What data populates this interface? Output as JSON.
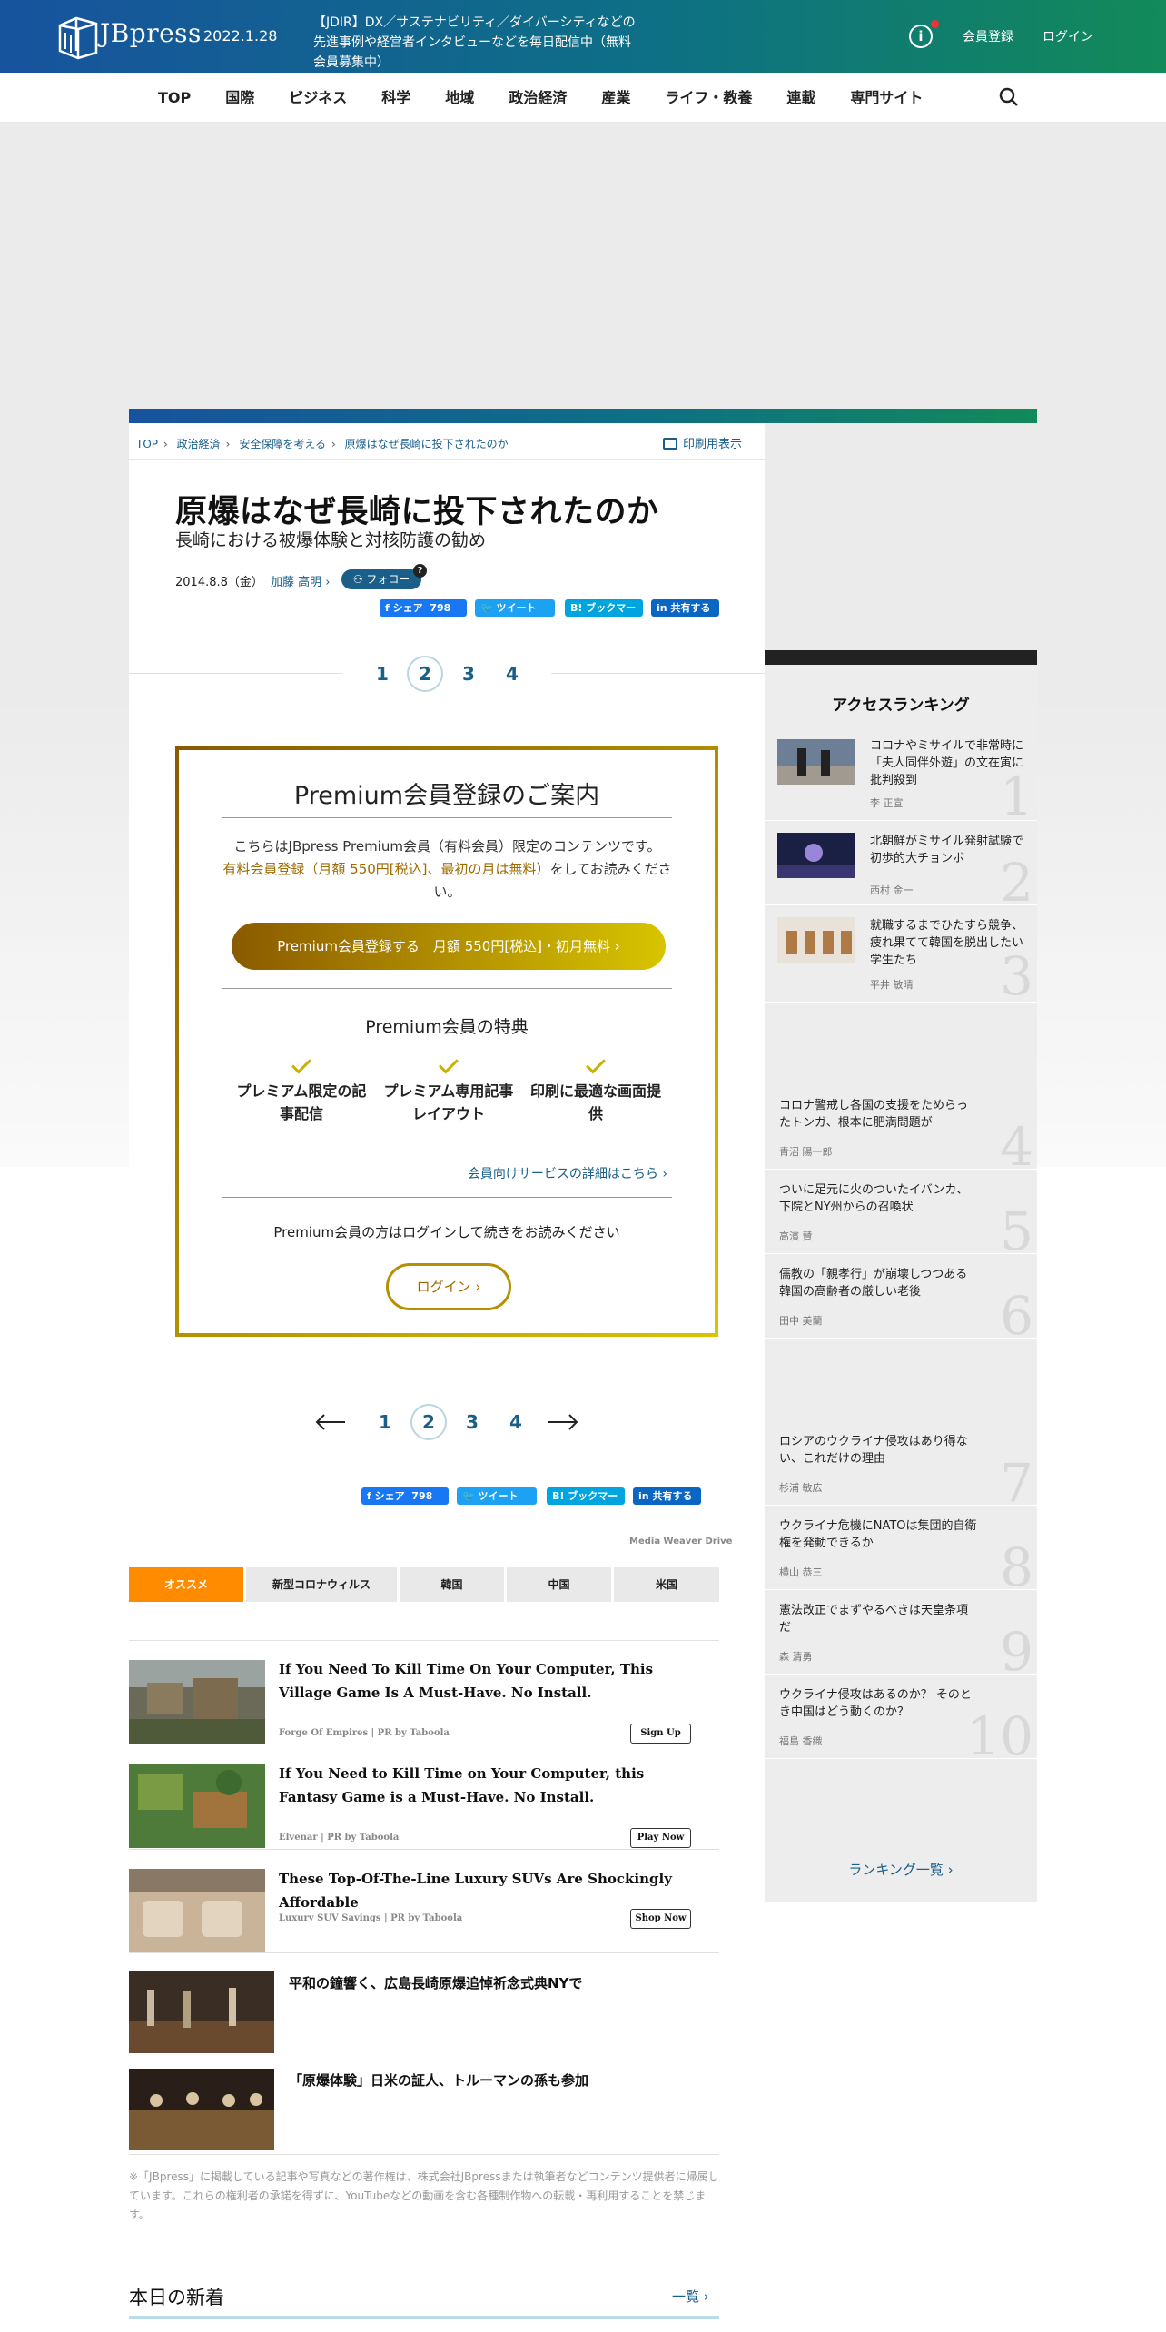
{
  "header": {
    "logo_text": "JBpress",
    "date": "2022.1.28",
    "notice": "【JDIR】DX／サステナビリティ／ダイバーシティなどの先進事例や経営者インタビューなどを毎日配信中（無料会員募集中）",
    "register": "会員登録",
    "login": "ログイン"
  },
  "nav": [
    "TOP",
    "国際",
    "ビジネス",
    "科学",
    "地域",
    "政治経済",
    "産業",
    "ライフ・教養",
    "連載",
    "専門サイト"
  ],
  "breadcrumb": [
    "TOP",
    "政治経済",
    "安全保障を考える",
    "原爆はなぜ長崎に投下されたのか"
  ],
  "print_label": "印刷用表示",
  "article": {
    "title": "原爆はなぜ長崎に投下されたのか",
    "subtitle": "長崎における被爆体験と対核防護の勧め",
    "date": "2014.8.8（金）",
    "author": "加藤 高明",
    "follow": "フォロー",
    "follow_help": "?"
  },
  "share": {
    "facebook": "シェア",
    "facebook_count": "798",
    "twitter": "ツイート",
    "hatena": "ブックマーク",
    "hatena_icon": "B!",
    "linkedin": "共有する"
  },
  "pagination": {
    "pages": [
      "1",
      "2",
      "3",
      "4"
    ],
    "current": "2"
  },
  "premium": {
    "title": "Premium会員登録のご案内",
    "text1": "こちらはJBpress Premium会員（有料会員）限定のコンテンツです。",
    "text2_link": "有料会員登録（月額 550円[税込]、最初の月は無料）",
    "text2_rest": "をしてお読みください。",
    "button": "Premium会員登録する　月額 550円[税込]・初月無料 ›",
    "benefits_title": "Premium会員の特典",
    "benefits": [
      "プレミアム限定の記事配信",
      "プレミアム専用記事レイアウト",
      "印刷に最適な画面提供"
    ],
    "details_link": "会員向けサービスの詳細はこちら ›",
    "login_text": "Premium会員の方はログインして続きをお読みください",
    "login_button": "ログイン ›"
  },
  "media_weaver": "Media Weaver Drive",
  "tabs": [
    "オススメ",
    "新型コロナウィルス",
    "韓国",
    "中国",
    "米国"
  ],
  "ads": [
    {
      "title": "If You Need To Kill Time On Your Computer, This Village Game Is A Must-Have. No Install.",
      "source": "Forge Of Empires | PR by Taboola",
      "button": "Sign Up"
    },
    {
      "title": "If You Need to Kill Time on Your Computer, this Fantasy Game is a Must-Have. No Install.",
      "source": "Elvenar | PR by Taboola",
      "button": "Play Now"
    },
    {
      "title": "These Top-Of-The-Line Luxury SUVs Are Shockingly Affordable",
      "source": "Luxury SUV Savings | PR by Taboola",
      "button": "Shop Now"
    }
  ],
  "related": [
    "平和の鐘響く、広島長崎原爆追悼祈念式典NYで",
    "「原爆体験」日米の証人、トルーマンの孫も参加"
  ],
  "copyright": "※「JBpress」に掲載している記事や写真などの著作権は、株式会社JBpressまたは執筆者などコンテンツ提供者に帰属しています。これらの権利者の承諾を得ずに、YouTubeなどの動画を含む各種制作物への転載・再利用することを禁じます。",
  "new_articles": {
    "title": "本日の新着",
    "more": "一覧 ›"
  },
  "ranking": {
    "title": "アクセスランキング",
    "items": [
      {
        "rank": "1",
        "title": "コロナやミサイルで非常時に「夫人同伴外遊」の文在寅に批判殺到",
        "author": "李 正宣"
      },
      {
        "rank": "2",
        "title": "北朝鮮がミサイル発射試験で初歩的大チョンボ",
        "author": "西村 金一"
      },
      {
        "rank": "3",
        "title": "就職するまでひたすら競争、疲れ果てて韓国を脱出したい学生たち",
        "author": "平井 敏晴"
      },
      {
        "rank": "4",
        "title": "コロナ警戒し各国の支援をためらったトンガ、根本に肥満問題が",
        "author": "青沼 陽一郎"
      },
      {
        "rank": "5",
        "title": "ついに足元に火のついたイバンカ、下院とNY州からの召喚状",
        "author": "高濱 賛"
      },
      {
        "rank": "6",
        "title": "儒教の「親孝行」が崩壊しつつある韓国の高齢者の厳しい老後",
        "author": "田中 美蘭"
      },
      {
        "rank": "7",
        "title": "ロシアのウクライナ侵攻はあり得ない、これだけの理由",
        "author": "杉浦 敏広"
      },
      {
        "rank": "8",
        "title": "ウクライナ危機にNATOは集団的自衛権を発動できるか",
        "author": "横山 恭三"
      },
      {
        "rank": "9",
        "title": "憲法改正でまずやるべきは天皇条項だ",
        "author": "森 清勇"
      },
      {
        "rank": "10",
        "title": "ウクライナ侵攻はあるのか？ そのとき中国はどう動くのか？",
        "author": "福島 香織"
      }
    ],
    "more": "ランキング一覧 ›"
  }
}
